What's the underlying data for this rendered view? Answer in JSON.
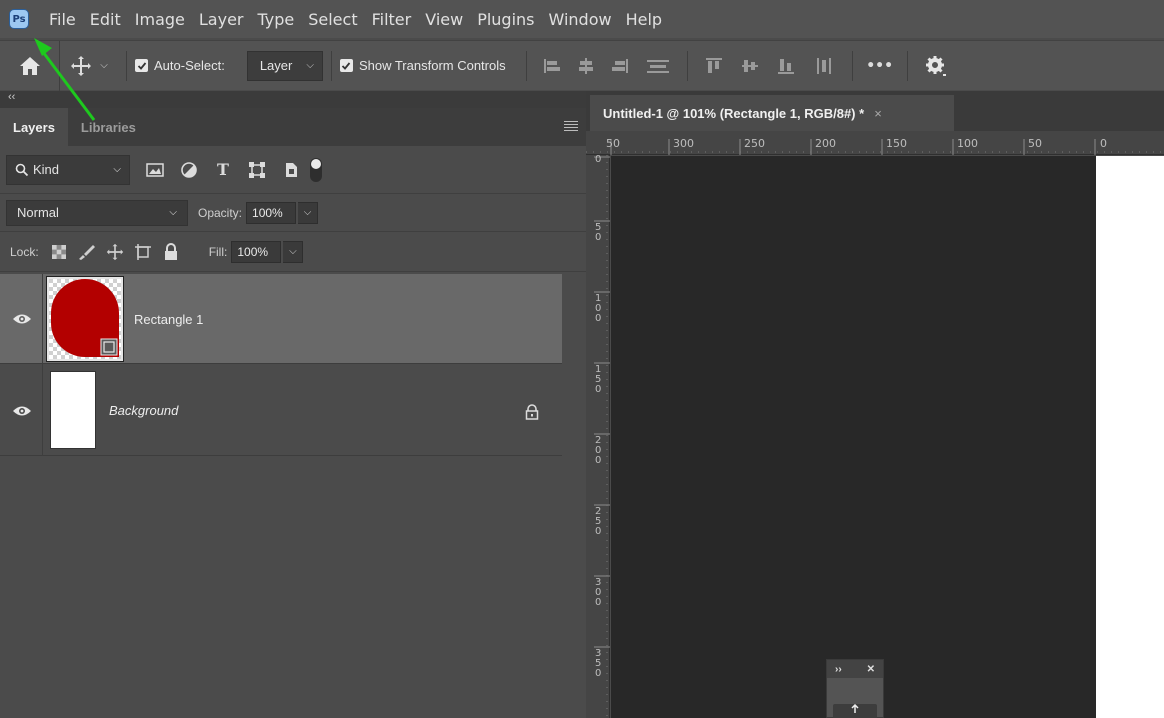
{
  "app": {
    "logo_text": "Ps",
    "menu": [
      "File",
      "Edit",
      "Image",
      "Layer",
      "Type",
      "Select",
      "Filter",
      "View",
      "Plugins",
      "Window",
      "Help"
    ]
  },
  "options_bar": {
    "auto_select_label": "Auto-Select:",
    "auto_select_checked": true,
    "auto_select_target": "Layer",
    "show_transform_label": "Show Transform Controls",
    "show_transform_checked": true,
    "more_label": "•••",
    "icons": [
      "home-icon",
      "move-tool-icon",
      "align-left-icon",
      "align-hcenter-icon",
      "align-right-icon",
      "distribute-vertical-icon",
      "align-top-icon",
      "align-vcenter-icon",
      "align-bottom-icon",
      "distribute-horizontal-icon",
      "settings-gear-icon"
    ]
  },
  "panel": {
    "collapse_label": "‹‹",
    "tabs": [
      {
        "label": "Layers",
        "active": true
      },
      {
        "label": "Libraries",
        "active": false
      }
    ],
    "filter": {
      "kind_label": "Kind"
    },
    "blend_mode": "Normal",
    "opacity_label": "Opacity:",
    "opacity_value": "100%",
    "lock_label": "Lock:",
    "fill_label": "Fill:",
    "fill_value": "100%",
    "layers": [
      {
        "name": "Rectangle 1",
        "selected": true,
        "visible": true,
        "thumb_color": "#b30000",
        "locked": false
      },
      {
        "name": "Background",
        "selected": false,
        "visible": true,
        "thumb_color": "#ffffff",
        "locked": true
      }
    ]
  },
  "document": {
    "tab_title": "Untitled-1 @ 101% (Rectangle 1, RGB/8#) *",
    "close_glyph": "×",
    "ruler_top_labels": [
      "50",
      "300",
      "250",
      "200",
      "150",
      "100",
      "50",
      "0"
    ],
    "ruler_left_labels": [
      "0",
      "50",
      "100",
      "150",
      "200",
      "250",
      "300",
      "350"
    ]
  },
  "mini_panel": {
    "expand_glyph": "››",
    "close_glyph": "✕"
  },
  "colors": {
    "annotation_arrow": "#1ec91e",
    "layer_fill": "#b30000"
  }
}
